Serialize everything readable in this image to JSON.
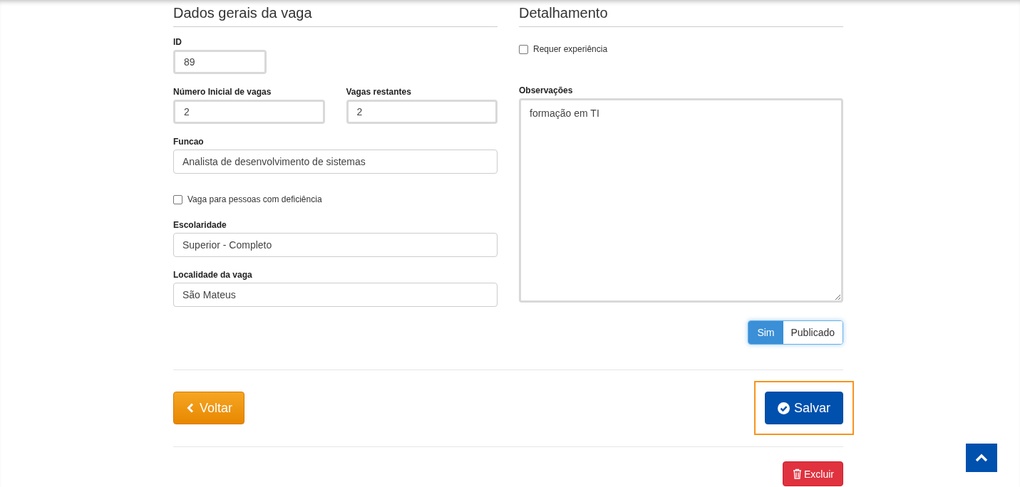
{
  "left_section": {
    "title": "Dados gerais da vaga",
    "id_field": {
      "label": "ID",
      "value": "89",
      "readonly": true
    },
    "count_fields": [
      {
        "label": "Número Inicial de vagas",
        "value": "2",
        "readonly": true
      },
      {
        "label": "Vagas restantes",
        "value": "2",
        "readonly": true
      }
    ],
    "function_field": {
      "label": "Funcao",
      "value": "Analista de desenvolvimento de sistemas",
      "readonly": false
    },
    "disability_checkbox": {
      "label": "Vaga para pessoas com deficiência",
      "checked": false
    },
    "fields": [
      {
        "label": "Escolaridade",
        "value": "Superior - Completo",
        "readonly": false
      },
      {
        "label": "Localidade da vaga",
        "value": "São Mateus",
        "readonly": false
      }
    ]
  },
  "right_section": {
    "title": "Detalhamento",
    "experience_checkbox": {
      "label": "Requer experiência",
      "checked": false
    },
    "notes": {
      "label": "Observações",
      "value": "formação em TI"
    },
    "publish_toggle": {
      "on_label": "Sim",
      "label": "Publicado",
      "on": true
    }
  },
  "actions": {
    "back": {
      "label": "Voltar"
    },
    "save": {
      "label": "Salvar",
      "focused": true
    },
    "delete": {
      "label": "Excluir"
    }
  }
}
